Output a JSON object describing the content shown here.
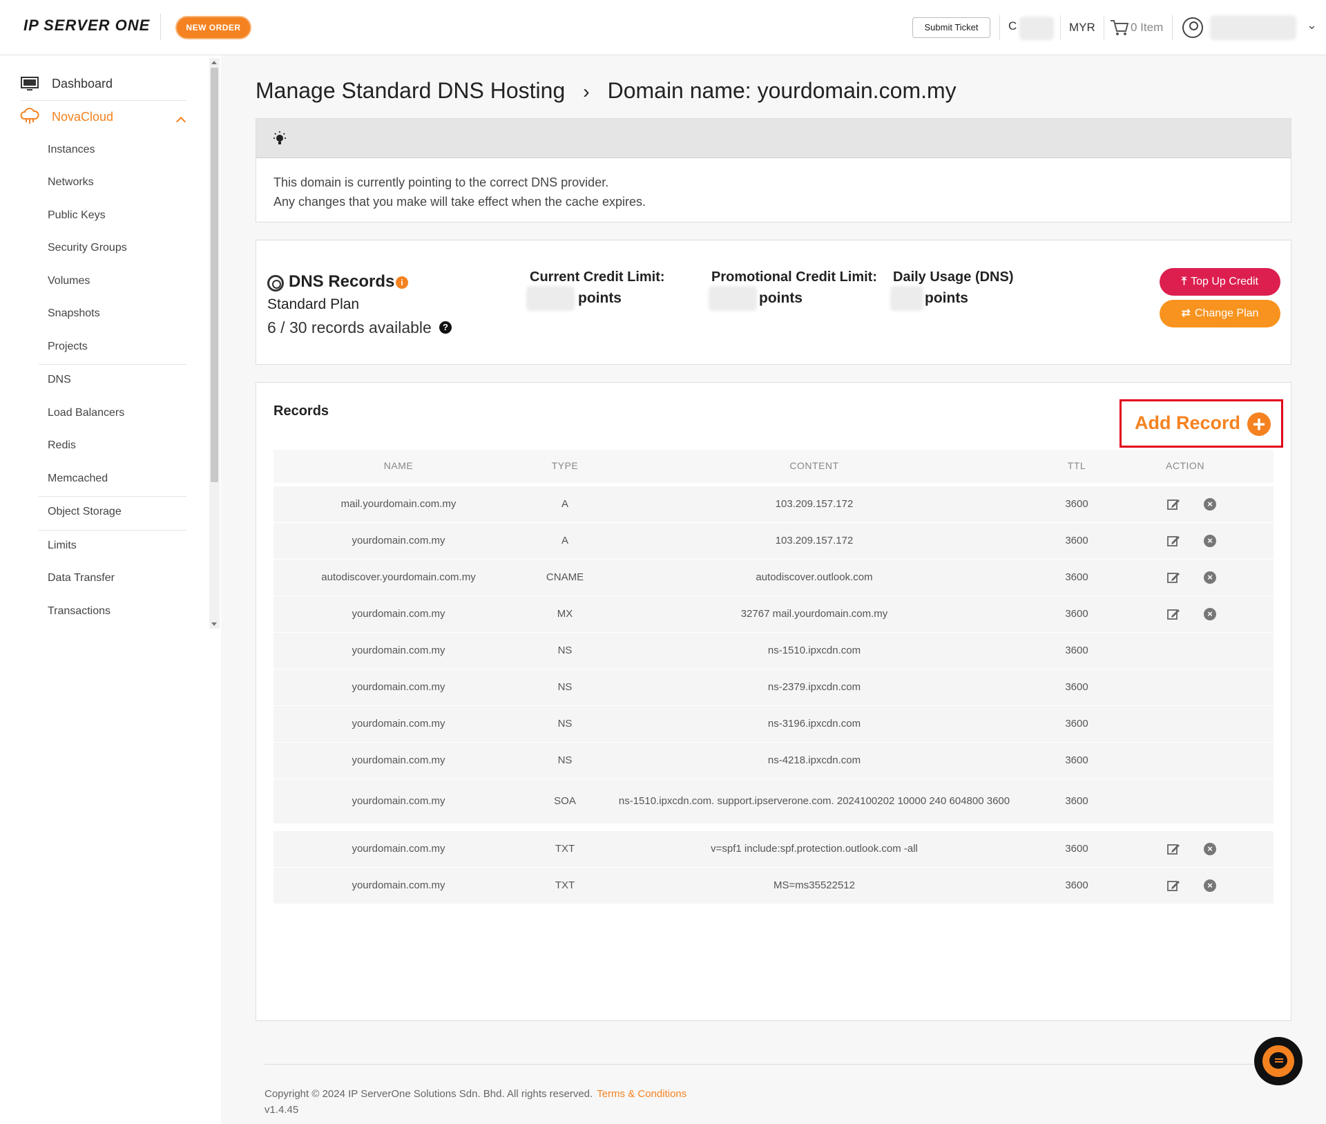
{
  "header": {
    "logo": "IP SERVER ONE",
    "new_order": "NEW ORDER",
    "submit_ticket": "Submit Ticket",
    "credit_prefix": "C",
    "currency": "MYR",
    "cart_items": "0 Item"
  },
  "sidebar": {
    "dashboard": "Dashboard",
    "novacloud": "NovaCloud",
    "items": [
      "Instances",
      "Networks",
      "Public Keys",
      "Security Groups",
      "Volumes",
      "Snapshots",
      "Projects",
      "DNS",
      "Load Balancers",
      "Redis",
      "Memcached",
      "Object Storage",
      "Limits",
      "Data Transfer",
      "Transactions"
    ]
  },
  "page": {
    "title": "Manage Standard DNS Hosting",
    "separator": "›",
    "subtitle": "Domain name: yourdomain.com.my"
  },
  "notice": {
    "line1": "This domain is currently pointing to the correct DNS provider.",
    "line2": "Any changes that you make will take effect when the cache expires."
  },
  "dns_card": {
    "title": "DNS Records",
    "info": "i",
    "plan": "Standard Plan",
    "available": "6 / 30 records available",
    "help": "?",
    "current_credit_label": "Current Credit Limit:",
    "promo_credit_label": "Promotional Credit Limit:",
    "daily_usage_label": "Daily Usage (DNS)",
    "points": "points",
    "top_up": "Top Up Credit",
    "change_plan": "Change Plan"
  },
  "records": {
    "title": "Records",
    "add_record": "Add Record",
    "columns": [
      "NAME",
      "TYPE",
      "CONTENT",
      "TTL",
      "ACTION"
    ],
    "rows": [
      {
        "name": "mail.yourdomain.com.my",
        "type": "A",
        "content": "103.209.157.172",
        "ttl": "3600",
        "editable": true
      },
      {
        "name": "yourdomain.com.my",
        "type": "A",
        "content": "103.209.157.172",
        "ttl": "3600",
        "editable": true
      },
      {
        "name": "autodiscover.yourdomain.com.my",
        "type": "CNAME",
        "content": "autodiscover.outlook.com",
        "ttl": "3600",
        "editable": true
      },
      {
        "name": "yourdomain.com.my",
        "type": "MX",
        "content": "32767 mail.yourdomain.com.my",
        "ttl": "3600",
        "editable": true
      },
      {
        "name": "yourdomain.com.my",
        "type": "NS",
        "content": "ns-1510.ipxcdn.com",
        "ttl": "3600",
        "editable": false
      },
      {
        "name": "yourdomain.com.my",
        "type": "NS",
        "content": "ns-2379.ipxcdn.com",
        "ttl": "3600",
        "editable": false
      },
      {
        "name": "yourdomain.com.my",
        "type": "NS",
        "content": "ns-3196.ipxcdn.com",
        "ttl": "3600",
        "editable": false
      },
      {
        "name": "yourdomain.com.my",
        "type": "NS",
        "content": "ns-4218.ipxcdn.com",
        "ttl": "3600",
        "editable": false
      },
      {
        "name": "yourdomain.com.my",
        "type": "SOA",
        "content": "ns-1510.ipxcdn.com. support.ipserverone.com. 2024100202 10000 240 604800 3600",
        "ttl": "3600",
        "editable": false
      },
      {
        "name": "yourdomain.com.my",
        "type": "TXT",
        "content": "v=spf1 include:spf.protection.outlook.com -all",
        "ttl": "3600",
        "editable": true
      },
      {
        "name": "yourdomain.com.my",
        "type": "TXT",
        "content": "MS=ms35522512",
        "ttl": "3600",
        "editable": true
      }
    ]
  },
  "footer": {
    "copyright": "Copyright © 2024 IP ServerOne Solutions Sdn. Bhd. All rights reserved.",
    "terms": "Terms & Conditions",
    "version": "v1.4.45"
  },
  "colors": {
    "accent": "#f58220",
    "topup": "#dc1f4f",
    "highlight_border": "#e1001a"
  }
}
